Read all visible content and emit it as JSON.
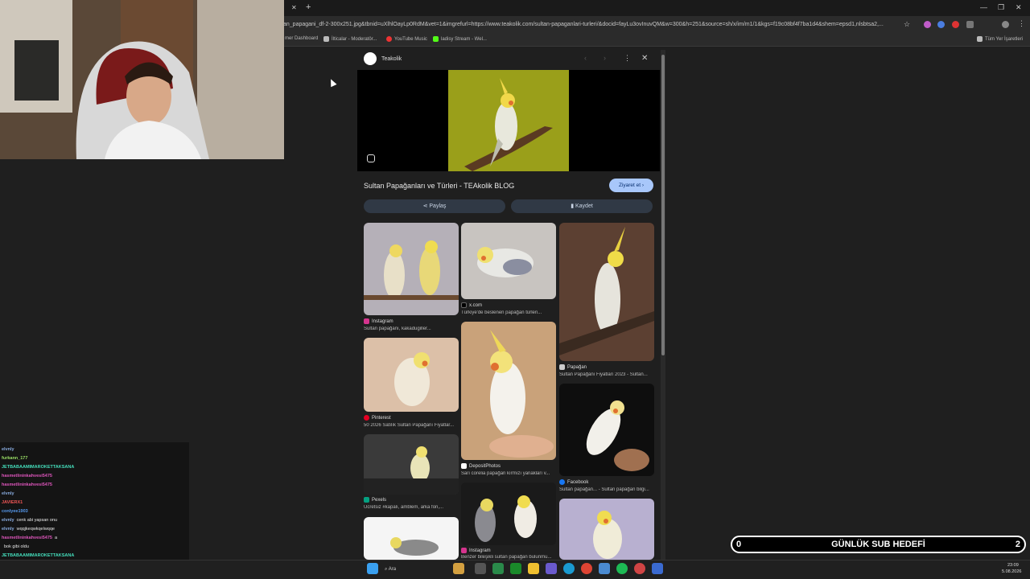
{
  "browser": {
    "url": "an_papagani_df-2-300x251.jpg&tbnid=uXlhlOayLp0RdM&vet=1&imgrefurl=https://www.teakolik.com/sultan-papaganlari-turleri/&docid=fayLu3ovInuvQM&w=300&h=251&source=sh/x/im/m1/1&kgs=f19c08bf4f7ba1d4&shem=epsd1,nlsbtsa2,...",
    "bookmarks": [
      "mer Dashboard",
      "İlticalar - Moderatör...",
      "YouTube Music",
      "ladisy Stream - Wel..."
    ],
    "all_bookmarks": "Tüm Yer İşaretleri",
    "window_controls": [
      "—",
      "❐",
      "✕"
    ],
    "new_tab": "+"
  },
  "panel": {
    "source": "Teakolik",
    "title": "Sultan Papağanları ve Türleri - TEAkolik BLOG",
    "visit_button": "Ziyaret et",
    "share_button": "Paylaş",
    "save_button": "Kaydet",
    "results": [
      {
        "source": "Instagram",
        "desc": "Sultan papağanı, kakadugiller..."
      },
      {
        "source": "x.com",
        "desc": "Türkiye'de beslenen papağan türleri..."
      },
      {
        "source": "Papağan",
        "desc": "Sultan Papağanı Fiyatları 2023 - Sultan..."
      },
      {
        "source": "Pinterest",
        "desc": "50 2026 Satılık Sultan Papağanı Fiyatlar..."
      },
      {
        "source": "DepositPhotos",
        "desc": "Sarı corelia papağan kırmızı yanakları v..."
      },
      {
        "source": "Facebook",
        "desc": "Sultan papağan... - Sultan papağan bilgi..."
      },
      {
        "source": "Pexels",
        "desc": "Ücretsiz #kapalı, amblem, arka fon,..."
      },
      {
        "source": "Instagram",
        "desc": "Benzer bileşikli sultan papağan bulunmu..."
      }
    ]
  },
  "chat": [
    {
      "user": "elvnly",
      "msg": "",
      "color": "#8ad"
    },
    {
      "user": "furkann_177",
      "msg": "",
      "color": "#9d6"
    },
    {
      "user": "JETBABAAMIMAROKETTAKSANA",
      "msg": "",
      "color": "#4db"
    },
    {
      "user": "hasmetlininkahvesi5475",
      "msg": "",
      "color": "#d5b"
    },
    {
      "user": "hasmetlininkahvesi5475",
      "msg": "",
      "color": "#d5b"
    },
    {
      "user": "elvnly",
      "msg": "",
      "color": "#8ad"
    },
    {
      "user": "JAVIERX1",
      "msg": "",
      "color": "#e55"
    },
    {
      "user": "conlyee1903",
      "msg": "",
      "color": "#59e"
    },
    {
      "user": "elvnly",
      "msg": "cenk abi yapsan onu",
      "color": "#8ad"
    },
    {
      "user": "elvnly",
      "msg": "wqqjkeqwkqelwqqe",
      "color": "#8ad"
    },
    {
      "user": "hasmetlininkahvesi5475",
      "msg": "a",
      "color": "#d5b"
    },
    {
      "user": "",
      "msg": "bok gibi oldu",
      "color": "#e55"
    },
    {
      "user": "JETBABAAMIMAROKETTAKSANA",
      "msg": "",
      "color": "#4db"
    },
    {
      "user": "",
      "msg": "ne kuşa abe kadın faxa",
      "color": "#cc4"
    },
    {
      "user": "JETBABAAMIMAROKETTAKSANA",
      "msg": "https://steam.google/ru/Kitabwa.2bv7w0w0WdPro",
      "color": "#4db"
    }
  ],
  "taskbar": {
    "search": "Ara",
    "time": "23:09",
    "date": "5.08.2026"
  },
  "sub_goal": {
    "label": "GÜNLÜK SUB HEDEFİ",
    "current": "0",
    "target": "2"
  }
}
